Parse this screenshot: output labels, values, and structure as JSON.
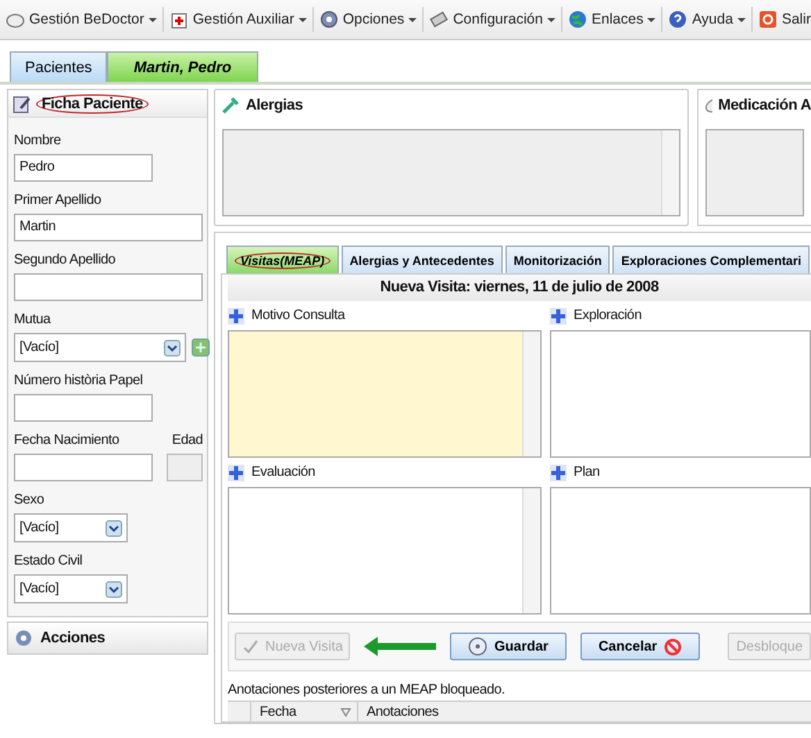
{
  "menu": [
    {
      "label": "Gestión BeDoctor",
      "dropdown": true
    },
    {
      "label": "Gestión Auxiliar",
      "dropdown": true
    },
    {
      "label": "Opciones",
      "dropdown": true
    },
    {
      "label": "Configuración",
      "dropdown": true
    },
    {
      "label": "Enlaces",
      "dropdown": true
    },
    {
      "label": "Ayuda",
      "dropdown": true
    },
    {
      "label": "Salir",
      "dropdown": false
    }
  ],
  "tabs": [
    {
      "label": "Pacientes",
      "selected": false
    },
    {
      "label": "Martin, Pedro",
      "selected": true
    }
  ],
  "patient_card": {
    "title": "Ficha Paciente",
    "circled": true,
    "fields": [
      {
        "kind": "text",
        "label": "Nombre",
        "value": "Pedro"
      },
      {
        "kind": "text",
        "label": "Primer Apellido",
        "value": "Martin"
      },
      {
        "kind": "text",
        "label": "Segundo Apellido"
      },
      {
        "kind": "select",
        "label": "Mutua",
        "value": "[Vacío]",
        "add_button": true
      },
      {
        "kind": "text",
        "label": "Número història Papel"
      },
      {
        "kind": "date_age",
        "label": "Fecha Nacimiento",
        "age_label": "Edad"
      },
      {
        "kind": "select",
        "label": "Sexo",
        "value": "[Vacío]",
        "add_button": false
      },
      {
        "kind": "select",
        "label": "Estado Civil",
        "value": "[Vacío]",
        "add_button": false
      }
    ]
  },
  "actions_panel": {
    "title": "Acciones"
  },
  "allergies_panel": {
    "title": "Alergias"
  },
  "medication_panel": {
    "title": "Medicación A"
  },
  "visit_tabs": [
    {
      "label": "Visitas(MEAP)",
      "selected": true,
      "circled": true
    },
    {
      "label": "Alergias y Antecedentes",
      "selected": false,
      "circled": false
    },
    {
      "label": "Monitorización",
      "selected": false,
      "circled": false
    },
    {
      "label": "Exploraciones Complementari",
      "selected": false,
      "circled": false
    }
  ],
  "visit_title": "Nueva Visita: viernes, 11 de julio de 2008",
  "sections": [
    {
      "label": "Motivo Consulta",
      "highlighted": true
    },
    {
      "label": "Exploración",
      "highlighted": false
    },
    {
      "label": "Evaluación",
      "highlighted": false
    },
    {
      "label": "Plan",
      "highlighted": false
    }
  ],
  "buttons": [
    {
      "kind": "new",
      "label": "Nueva Visita",
      "disabled": true
    },
    {
      "kind": "save",
      "label": "Guardar",
      "disabled": false
    },
    {
      "kind": "cancel",
      "label": "Cancelar",
      "disabled": false
    },
    {
      "kind": "unlock",
      "label": "Desbloque",
      "disabled": true
    }
  ],
  "annotations_note": "Anotaciones posteriores a un MEAP bloqueado.",
  "annotations_table": {
    "columns": [
      {
        "label": "Fecha",
        "sortable": true
      },
      {
        "label": "Anotaciones",
        "sortable": false
      }
    ]
  }
}
